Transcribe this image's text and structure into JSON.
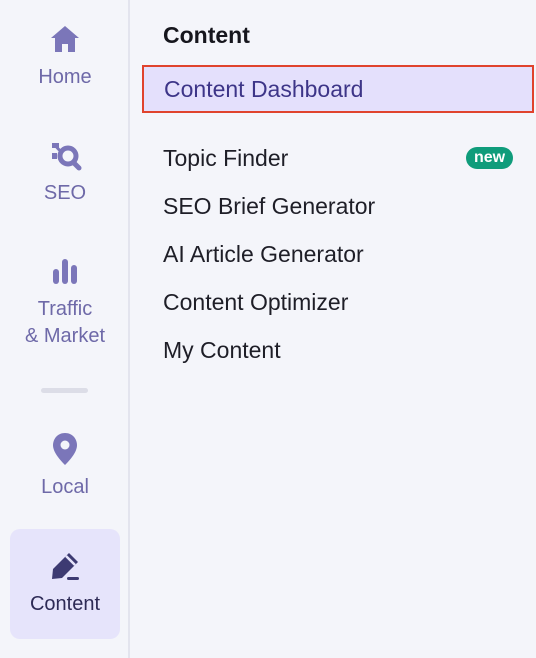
{
  "rail": {
    "items": [
      {
        "label": "Home",
        "icon": "home-icon",
        "active": false
      },
      {
        "label": "SEO",
        "icon": "seo-icon",
        "active": false
      },
      {
        "label": "Traffic\n& Market",
        "label_line1": "Traffic",
        "label_line2": "& Market",
        "icon": "bar-chart-icon",
        "active": false
      },
      {
        "label": "Local",
        "icon": "map-pin-icon",
        "active": false
      },
      {
        "label": "Content",
        "icon": "pen-icon",
        "active": true
      }
    ]
  },
  "panel": {
    "title": "Content",
    "items": [
      {
        "label": "Content Dashboard",
        "selected": true
      },
      {
        "label": "Topic Finder",
        "badge": "new"
      },
      {
        "label": "SEO Brief Generator"
      },
      {
        "label": "AI Article Generator"
      },
      {
        "label": "Content Optimizer"
      },
      {
        "label": "My Content"
      }
    ]
  },
  "colors": {
    "accent": "#6e69a8",
    "active_bg": "#e6e4fb",
    "selected_border": "#e0432d",
    "badge_bg": "#0f9c7b"
  }
}
